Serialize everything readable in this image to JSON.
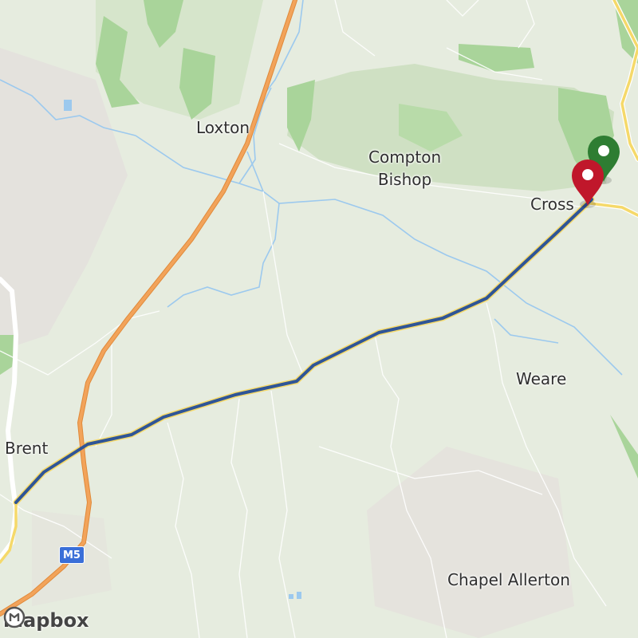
{
  "map": {
    "places": [
      {
        "id": "loxton",
        "name": "Loxton"
      },
      {
        "id": "compton-bishop",
        "name": "Compton\nBishop"
      },
      {
        "id": "cross",
        "name": "Cross"
      },
      {
        "id": "weare",
        "name": "Weare"
      },
      {
        "id": "brent",
        "name": "Brent"
      },
      {
        "id": "chapel-allerton",
        "name": "Chapel Allerton"
      }
    ],
    "road_shield": "M5",
    "attribution": "mapbox",
    "route": {
      "color": "#2f5597",
      "start_marker_color": "#2e7d32",
      "end_marker_color": "#c0172b"
    },
    "colors": {
      "land": "#e6ecdf",
      "wood": "#a9d49a",
      "hill_shade": "#cfe0c3",
      "motorway": "#f2a35a",
      "minor_road": "#f5d96a",
      "water": "#9cc9ee",
      "urban": "#e4e0dc"
    }
  }
}
